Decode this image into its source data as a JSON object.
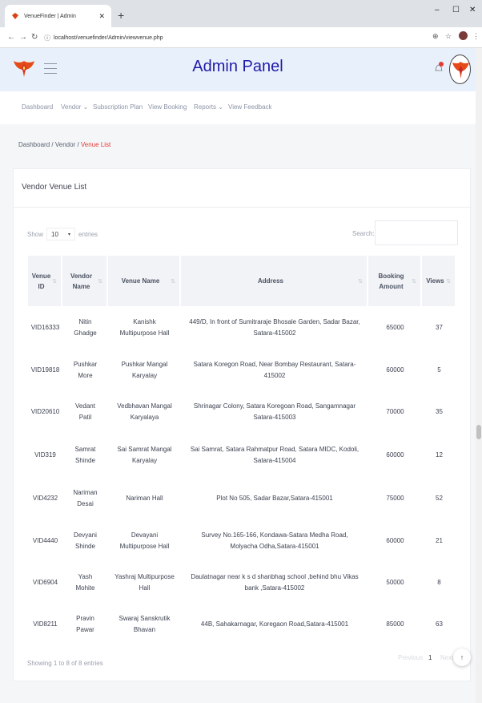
{
  "browser": {
    "tab_title": "VenueFinder | Admin",
    "url": "localhost/venuefinder/Admin/viewvenue.php"
  },
  "header": {
    "title": "Admin Panel"
  },
  "menu": [
    {
      "label": "Dashboard"
    },
    {
      "label": "Vendor"
    },
    {
      "label": "Subscription Plan"
    },
    {
      "label": "View Booking"
    },
    {
      "label": "Reports"
    },
    {
      "label": "View Feedback"
    }
  ],
  "breadcrumb": {
    "home": "Dashboard",
    "parent": "Vendor",
    "current": "Venue List",
    "sep": "/"
  },
  "card": {
    "title": "Vendor Venue List"
  },
  "controls": {
    "show": "Show",
    "entries_value": "10",
    "entries": "entries",
    "search": "Search:"
  },
  "table": {
    "headers": [
      "Venue ID",
      "Vendor Name",
      "Venue Name",
      "Address",
      "Booking Amount",
      "Views"
    ],
    "rows": [
      [
        "VID16333",
        "Nitin Ghadge",
        "Kanishk Multipurpose Hall",
        "449/D, In front of Sumitraraje Bhosale Garden, Sadar Bazar, Satara-415002",
        "65000",
        "37"
      ],
      [
        "VID19818",
        "Pushkar More",
        "Pushkar Mangal Karyalay",
        "Satara Koregon Road, Near Bombay Restaurant, Satara-415002",
        "60000",
        "5"
      ],
      [
        "VID20610",
        "Vedant Patil",
        "Vedbhavan Mangal Karyalaya",
        "Shrinagar Colony, Satara Koregoan Road, Sangamnagar Satara-415003",
        "70000",
        "35"
      ],
      [
        "VID319",
        "Samrat Shinde",
        "Sai Samrat Mangal Karyalay",
        "Sai Samrat, Satara Rahmatpur Road, Satara MIDC, Kodoli, Satara-415004",
        "60000",
        "12"
      ],
      [
        "VID4232",
        "Nariman Desai",
        "Nariman Hall",
        "Plot No 505, Sadar Bazar,Satara-415001",
        "75000",
        "52"
      ],
      [
        "VID4440",
        "Devyani Shinde",
        "Devayani Multipurpose Hall",
        "Survey No.165-166, Kondawa-Satara Medha Road, Molyacha Odha,Satara-415001",
        "60000",
        "21"
      ],
      [
        "VID6904",
        "Yash Mohite",
        "Yashraj Multipurpose Hall",
        "Daulatnagar near k s d shanbhag school ,behind bhu Vikas bank ,Satara-415002",
        "50000",
        "8"
      ],
      [
        "VID8211",
        "Pravin Pawar",
        "Swaraj Sanskrutik Bhavan",
        "44B, Sahakarnagar, Koregaon Road,Satara-415001",
        "85000",
        "63"
      ]
    ]
  },
  "footer": {
    "info": "Showing 1 to 8 of 8 entries",
    "previous": "Previous",
    "page": "1",
    "next": "Next"
  }
}
